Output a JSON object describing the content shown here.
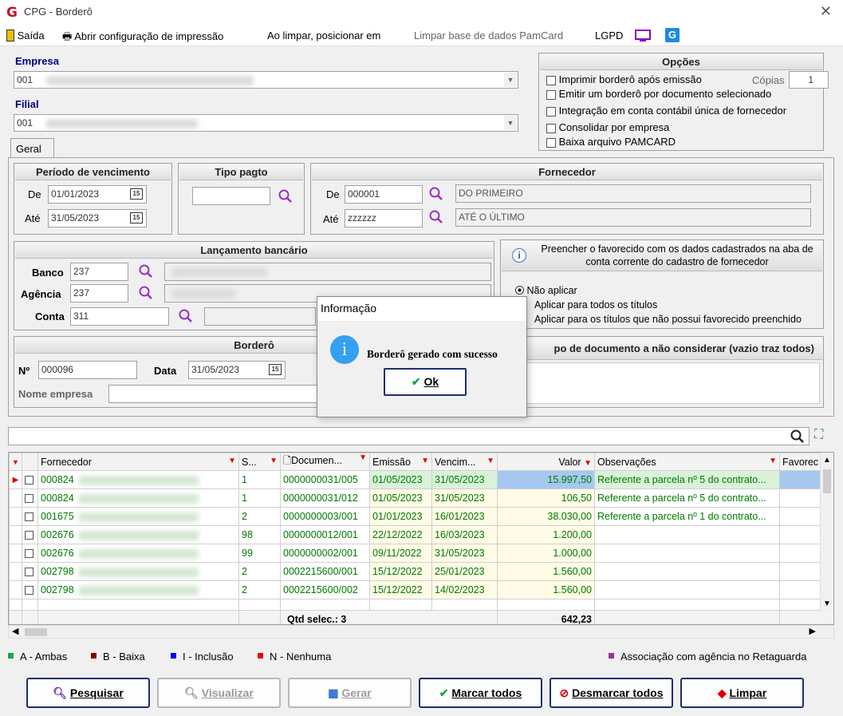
{
  "window": {
    "title": "CPG - Borderô"
  },
  "toolbar": {
    "exit": "Saída",
    "print_config": "Abrir configuração de impressão",
    "on_clear": "Ao limpar, posicionar em",
    "clear_pamcard": "Limpar base de dados PamCard",
    "lgpd": "LGPD"
  },
  "empresa": {
    "label": "Empresa",
    "value": "001"
  },
  "filial": {
    "label": "Filial",
    "value": "001"
  },
  "opcoes": {
    "title": "Opções",
    "items": [
      "Imprimir borderô após emissão",
      "Emitir um borderô por documento selecionado",
      "Integração em conta contábil única de fornecedor",
      "Consolidar por empresa",
      "Baixa arquivo PAMCARD"
    ],
    "copies_label": "Cópias",
    "copies_value": "1"
  },
  "tab": "Geral",
  "periodo": {
    "title": "Período de vencimento",
    "de_label": "De",
    "de": "01/01/2023",
    "ate_label": "Até",
    "ate": "31/05/2023"
  },
  "tipo_pagto": {
    "title": "Tipo pagto",
    "value": ""
  },
  "fornecedor": {
    "title": "Fornecedor",
    "de_label": "De",
    "de_code": "000001",
    "de_name": "DO PRIMEIRO",
    "ate_label": "Até",
    "ate_code": "zzzzzz",
    "ate_name": "ATÉ O ÚLTIMO"
  },
  "lancamento": {
    "title": "Lançamento bancário",
    "banco_label": "Banco",
    "banco": "237",
    "agencia_label": "Agência",
    "agencia": "237",
    "conta_label": "Conta",
    "conta": "311"
  },
  "favorecido": {
    "title": "Preencher o favorecido com os dados cadastrados na aba de conta corrente do cadastro de fornecedor",
    "options": [
      "Não aplicar",
      "Aplicar para todos os títulos",
      "Aplicar para os títulos que não possui favorecido preenchido"
    ]
  },
  "bordero": {
    "title": "Borderô",
    "num_label": "Nº",
    "num": "000096",
    "data_label": "Data",
    "data": "31/05/2023",
    "nome_label": "Nome empresa"
  },
  "tipo_doc": {
    "title": "po de documento a não considerar (vazio traz todos)"
  },
  "dialog": {
    "title": "Informação",
    "message": "Borderô gerado com sucesso",
    "ok": "Ok"
  },
  "grid": {
    "columns": [
      "Fornecedor",
      "S...",
      "Documen...",
      "Emissão",
      "Vencim...",
      "Valor",
      "Observações",
      "Favorec"
    ],
    "rows": [
      {
        "forn": "000824",
        "s": "1",
        "doc": "0000000031/005",
        "emissao": "01/05/2023",
        "venc": "31/05/2023",
        "valor": "15.997,50",
        "obs": "Referente a parcela nº 5 do contrato..."
      },
      {
        "forn": "000824",
        "s": "1",
        "doc": "0000000031/012",
        "emissao": "01/05/2023",
        "venc": "31/05/2023",
        "valor": "106,50",
        "obs": "Referente a parcela nº 5 do contrato..."
      },
      {
        "forn": "001675",
        "s": "2",
        "doc": "0000000003/001",
        "emissao": "01/01/2023",
        "venc": "16/01/2023",
        "valor": "38.030,00",
        "obs": "Referente a parcela nº 1 do contrato..."
      },
      {
        "forn": "002676",
        "s": "98",
        "doc": "0000000012/001",
        "emissao": "22/12/2022",
        "venc": "16/03/2023",
        "valor": "1.200,00",
        "obs": ""
      },
      {
        "forn": "002676",
        "s": "99",
        "doc": "0000000002/001",
        "emissao": "09/11/2022",
        "venc": "31/05/2023",
        "valor": "1.000,00",
        "obs": ""
      },
      {
        "forn": "002798",
        "s": "2",
        "doc": "0002215600/001",
        "emissao": "15/12/2022",
        "venc": "25/01/2023",
        "valor": "1.560,00",
        "obs": ""
      },
      {
        "forn": "002798",
        "s": "2",
        "doc": "0002215600/002",
        "emissao": "15/12/2022",
        "venc": "14/02/2023",
        "valor": "1.560,00",
        "obs": ""
      }
    ],
    "footer_qtd": "Qtd selec.: 3",
    "footer_total": "642,23"
  },
  "legend": {
    "ambas": "A - Ambas",
    "baixa": "B - Baixa",
    "inclusao": "I - Inclusão",
    "nenhuma": "N - Nenhuma",
    "assoc": "Associação com agência no Retaguarda",
    "colors": {
      "ambas": "#1aa34a",
      "baixa": "#8b0000",
      "inclusao": "#0000ee",
      "nenhuma": "#ee0000",
      "assoc": "#9b30a0"
    }
  },
  "buttons": {
    "pesquisar": "Pesquisar",
    "visualizar": "Visualizar",
    "gerar": "Gerar",
    "marcar": "Marcar todos",
    "desmarcar": "Desmarcar todos",
    "limpar": "Limpar"
  }
}
